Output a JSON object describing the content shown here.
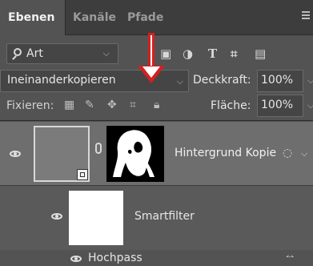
{
  "tabs": [
    {
      "label": "Ebenen",
      "active": true
    },
    {
      "label": "Kanäle",
      "active": false
    },
    {
      "label": "Pfade",
      "active": false
    }
  ],
  "filter": {
    "label": "Art"
  },
  "filter_icons": [
    "image-filter-icon",
    "adjustment-filter-icon",
    "type-filter-icon",
    "shape-filter-icon",
    "smartobject-filter-icon"
  ],
  "filter_glyphs": {
    "type": "T"
  },
  "blend": {
    "value": "Ineinanderkopieren"
  },
  "opacity": {
    "label": "Deckkraft:",
    "value": "100%"
  },
  "lock": {
    "label": "Fixieren:"
  },
  "fill": {
    "label": "Fläche:",
    "value": "100%"
  },
  "layers": [
    {
      "name": "Hintergrund Kopie"
    }
  ],
  "smartfilter": {
    "label": "Smartfilter"
  },
  "filters": [
    {
      "name": "Hochpass"
    }
  ],
  "colors": {
    "panel": "#535353",
    "selected_row": "#6e6e6e",
    "arrow": "#d42020"
  }
}
